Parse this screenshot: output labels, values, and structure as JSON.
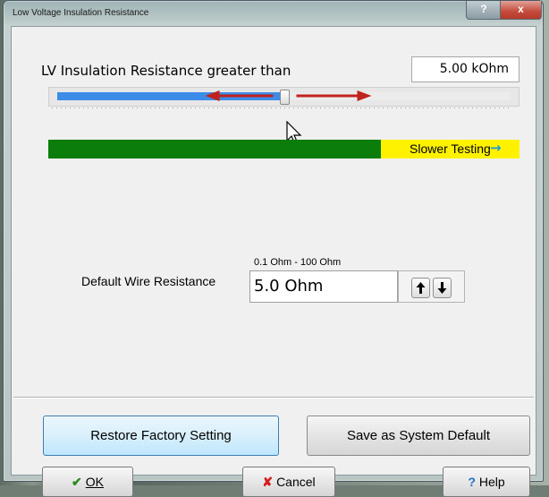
{
  "window": {
    "title": "Low Voltage Insulation Resistance",
    "help_glyph": "?",
    "close_glyph": "x"
  },
  "insulation": {
    "label": "LV Insulation Resistance greater than",
    "value": "5.00 kOhm",
    "slider_position_fraction": 0.5
  },
  "speed_bar": {
    "label": "Slower Testing",
    "arrow_glyph": "→",
    "green_color": "#0a7d0a",
    "yellow_color": "#fff200",
    "yellow_start_fraction": 0.705
  },
  "wire_resistance": {
    "range_text": "0.1 Ohm - 100 Ohm",
    "label": "Default Wire Resistance",
    "value": "5.0 Ohm",
    "up_glyph": "🡑",
    "down_glyph": "🡓"
  },
  "buttons": {
    "restore": "Restore Factory Setting",
    "save_default": "Save as System Default",
    "ok": "OK",
    "cancel": "Cancel",
    "help": "Help"
  },
  "icons": {
    "ok_icon": "check-icon",
    "cancel_icon": "x-icon",
    "help_icon": "question-icon",
    "slider_arrows": "red-double-arrow-icon"
  },
  "colors": {
    "slider_fill": "#3d8de8",
    "arrow_red": "#c0221c",
    "accent_blue": "#1b9ad6"
  }
}
